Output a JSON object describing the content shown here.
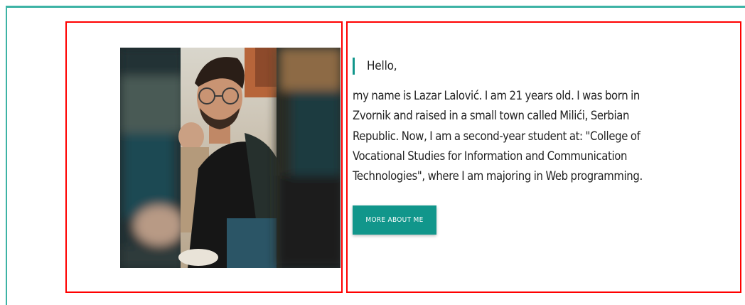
{
  "about": {
    "greeting": "Hello,",
    "bio": "my name is Lazar Lalović. I am 21 years old. I was born in Zvornik and raised in a small town called Milići, Serbian Republic. Now, I am a second-year student at: \"College of Vocational Studies for Information and Communication Technologies\", where I am majoring in Web programming.",
    "button_label": "MORE ABOUT ME"
  },
  "colors": {
    "accent": "#11968b",
    "frame": "#3db3a5",
    "highlight_box": "#ff0000"
  }
}
